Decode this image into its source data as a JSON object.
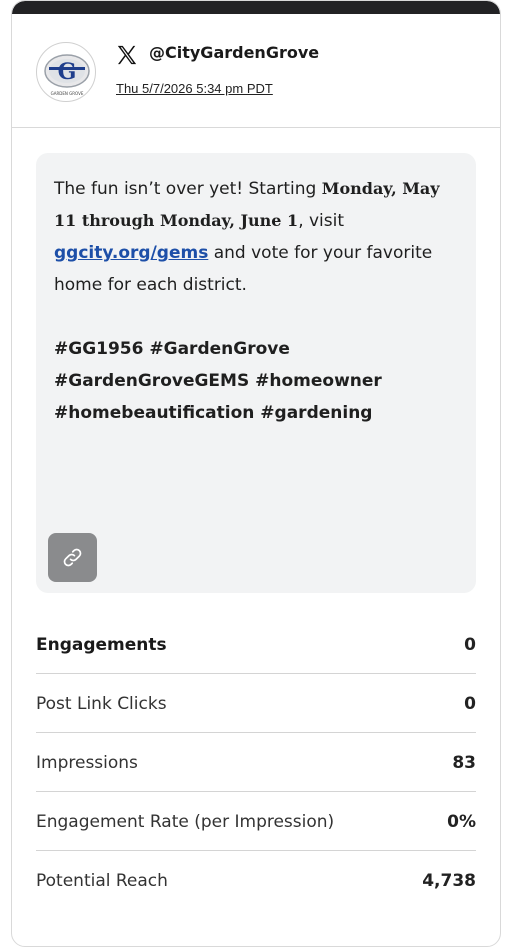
{
  "account": {
    "handle": "@CityGardenGrove",
    "timestamp": "Thu 5/7/2026 5:34 pm PDT",
    "avatar_logo_text": "Garden Grove",
    "network_icon": "x-logo-icon"
  },
  "post": {
    "text_intro": "The fun isn’t over yet! Starting ",
    "date_range_1": "Monday, May 11 through Monday, June 1",
    "text_visit": ", visit ",
    "link": "ggcity.org/gems",
    "text_after": " and vote for your favorite home for each district.",
    "hashtags": "#GG1956 #GardenGrove #GardenGroveGEMS #homeowner #homebeautification #gardening",
    "link_icon": "link-icon"
  },
  "stats": [
    {
      "label": "Engagements",
      "value": "0"
    },
    {
      "label": "Post Link Clicks",
      "value": "0"
    },
    {
      "label": "Impressions",
      "value": "83"
    },
    {
      "label": "Engagement Rate (per Impression)",
      "value": "0%"
    },
    {
      "label": "Potential Reach",
      "value": "4,738"
    }
  ]
}
